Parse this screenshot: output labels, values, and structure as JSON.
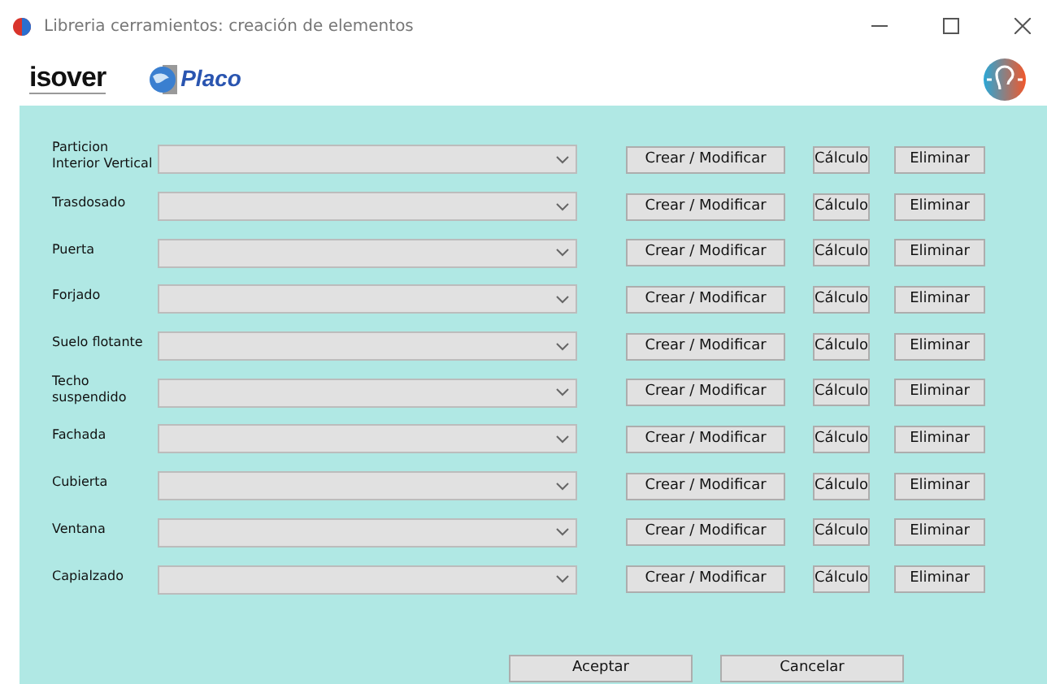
{
  "window": {
    "title": "Libreria cerramientos: creación de elementos"
  },
  "logos": {
    "isover": "isover",
    "placo": "Placo"
  },
  "rows": [
    {
      "label": "Particion Interior Vertical",
      "buttons": [
        "Crear / Modificar",
        "Cálculo",
        "Eliminar"
      ]
    },
    {
      "label": "Trasdosado",
      "buttons": [
        "Crear / Modificar",
        "Cálculo",
        "Eliminar"
      ]
    },
    {
      "label": "Puerta",
      "buttons": [
        "Crear / Modificar",
        "Cálculo",
        "Eliminar"
      ]
    },
    {
      "label": "Forjado",
      "buttons": [
        "Crear / Modificar",
        "Cálculo",
        "Eliminar"
      ]
    },
    {
      "label": "Suelo flotante",
      "buttons": [
        "Crear / Modificar",
        "Cálculo",
        "Eliminar"
      ]
    },
    {
      "label": "Techo suspendido",
      "buttons": [
        "Crear / Modificar",
        "Cálculo",
        "Eliminar"
      ]
    },
    {
      "label": "Fachada",
      "buttons": [
        "Crear / Modificar",
        "Cálculo",
        "Eliminar"
      ]
    },
    {
      "label": "Cubierta",
      "buttons": [
        "Crear / Modificar",
        "Cálculo",
        "Eliminar"
      ]
    },
    {
      "label": "Ventana",
      "buttons": [
        "Crear / Modificar",
        "Cálculo",
        "Eliminar"
      ]
    },
    {
      "label": "Capialzado",
      "buttons": [
        "Crear / Modificar",
        "Cálculo",
        "Eliminar"
      ]
    }
  ],
  "footer_buttons": [
    "Aceptar",
    "Cancelar"
  ]
}
